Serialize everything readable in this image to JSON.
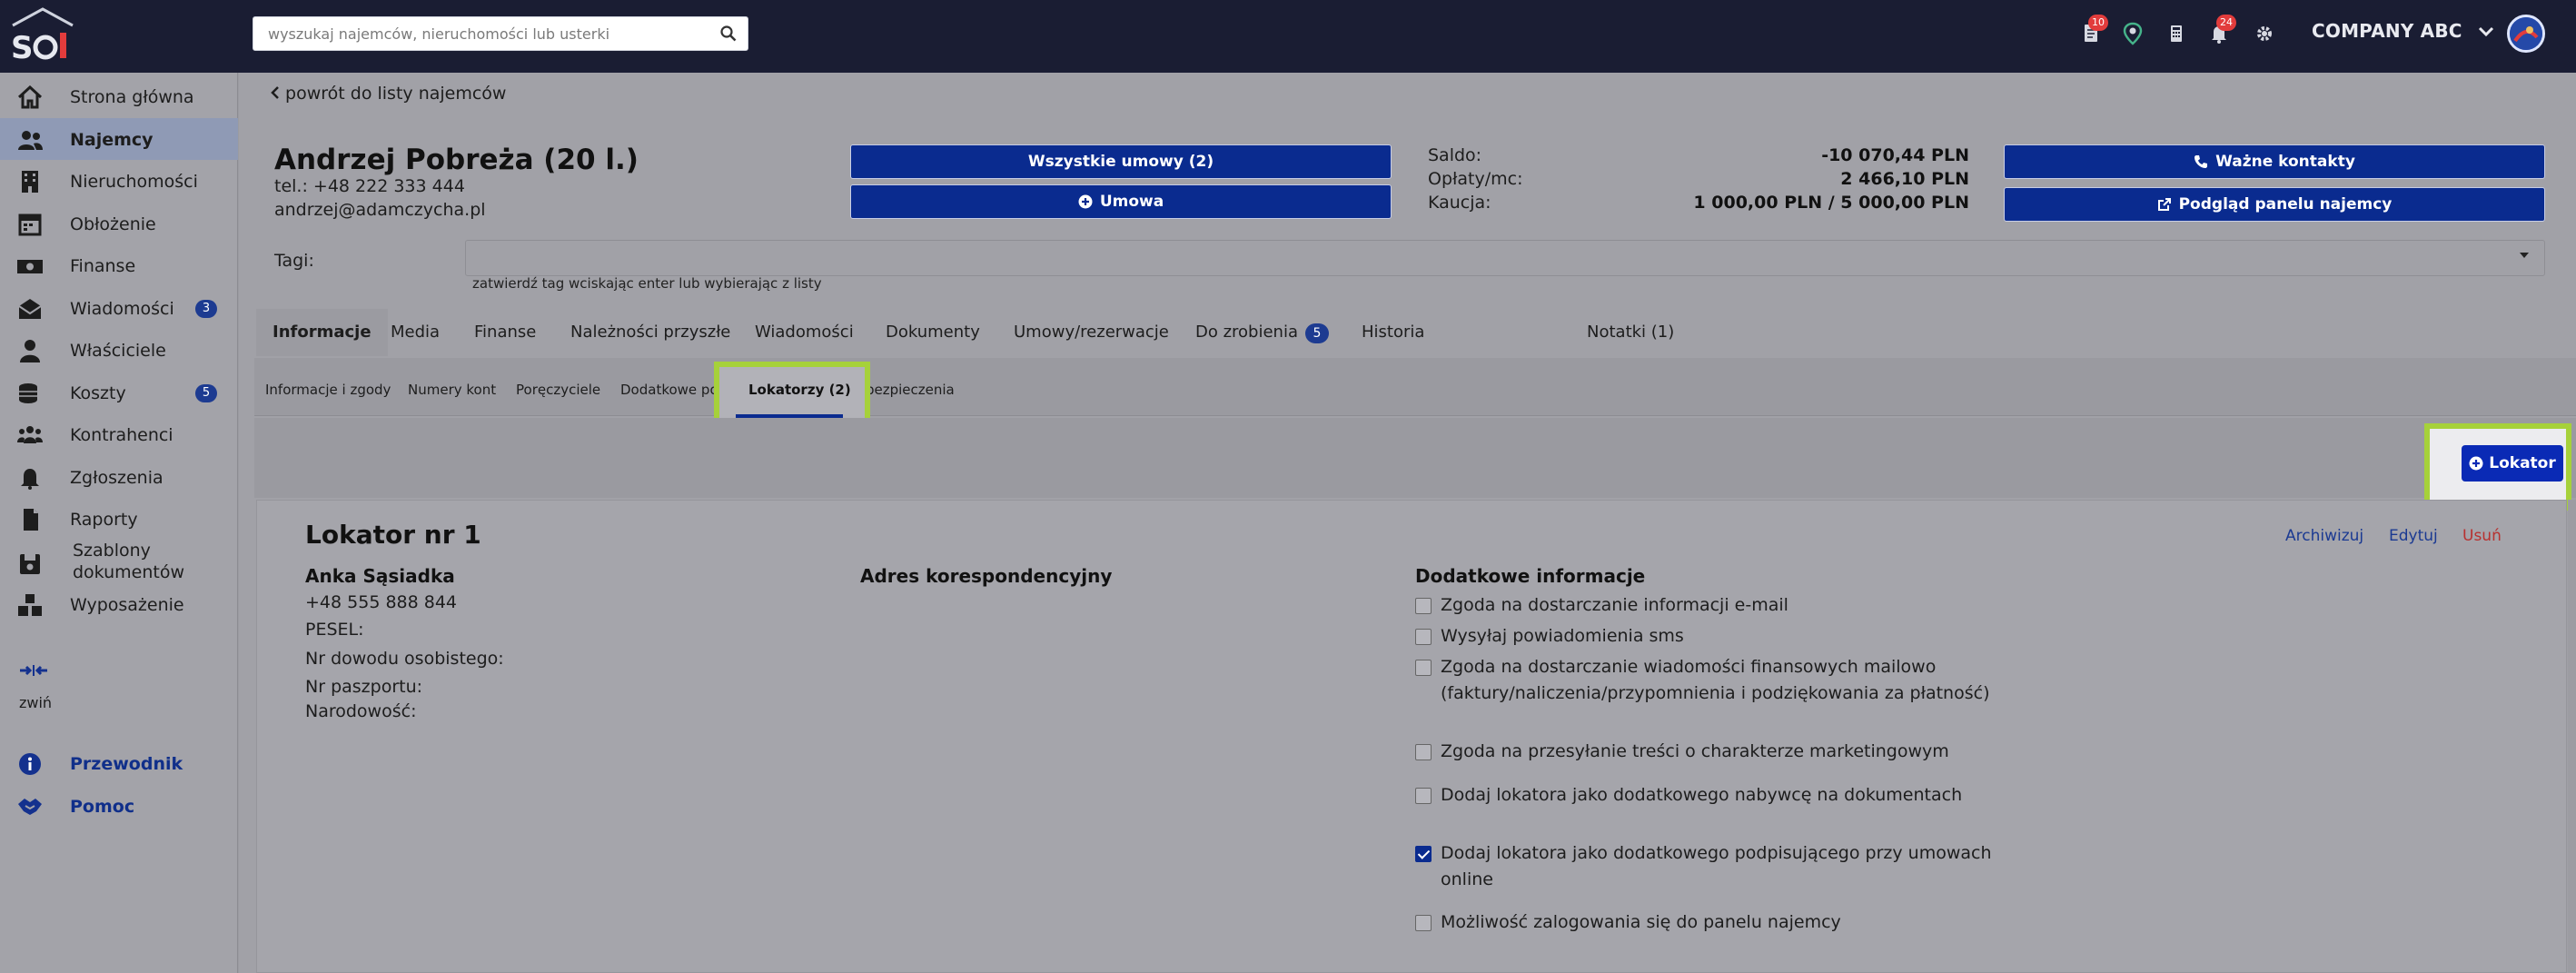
{
  "search": {
    "placeholder": "wyszukaj najemców, nieruchomości lub usterki"
  },
  "topbar": {
    "badges": {
      "documents": "10",
      "bell": "24"
    },
    "company": "COMPANY ABC"
  },
  "sidebar": {
    "items": [
      {
        "label": "Strona główna",
        "icon": "home-icon"
      },
      {
        "label": "Najemcy",
        "icon": "users-icon"
      },
      {
        "label": "Nieruchomości",
        "icon": "building-icon"
      },
      {
        "label": "Obłożenie",
        "icon": "calendar-icon"
      },
      {
        "label": "Finanse",
        "icon": "money-icon"
      },
      {
        "label": "Wiadomości",
        "icon": "envelope-icon",
        "count": "3"
      },
      {
        "label": "Właściciele",
        "icon": "owner-icon"
      },
      {
        "label": "Koszty",
        "icon": "coins-icon",
        "count": "5"
      },
      {
        "label": "Kontrahenci",
        "icon": "group-icon"
      },
      {
        "label": "Zgłoszenia",
        "icon": "bell-icon"
      },
      {
        "label": "Raporty",
        "icon": "file-icon"
      },
      {
        "label_line1": "Szablony",
        "label_line2": "dokumentów",
        "icon": "save-icon"
      },
      {
        "label": "Wyposażenie",
        "icon": "boxes-icon"
      }
    ],
    "collapse_label": "zwiń",
    "guide_label": "Przewodnik",
    "help_label": "Pomoc"
  },
  "main": {
    "back_link": "powrót do listy najemców",
    "tenant_name": "Andrzej Pobreża (20  l.)",
    "phone": "tel.: +48 222 333 444",
    "email": "andrzej@adamczycha.pl",
    "all_contracts_button": "Wszystkie umowy (2)",
    "contract_button": "Umowa",
    "finance": {
      "balance_label": "Saldo:",
      "balance_value": "-10 070,44 PLN",
      "fees_label": "Opłaty/mc:",
      "fees_value": "2 466,10 PLN",
      "deposit_label": "Kaucja:",
      "deposit_value": "1 000,00 PLN / 5 000,00 PLN"
    },
    "important_contacts_button": "Ważne kontakty",
    "tenant_panel_button": "Podgląd panelu najemcy",
    "tags_label": "Tagi:",
    "tags_hint": "zatwierdź tag wciskając enter lub wybierając z listy",
    "tabs": [
      {
        "label": "Informacje"
      },
      {
        "label": "Media"
      },
      {
        "label": "Finanse"
      },
      {
        "label": "Należności przyszłe"
      },
      {
        "label": "Wiadomości"
      },
      {
        "label": "Dokumenty"
      },
      {
        "label": "Umowy/rezerwacje"
      },
      {
        "label": "Do zrobienia",
        "count": "5"
      },
      {
        "label": "Historia"
      },
      {
        "label": "Notatki (1)"
      }
    ],
    "subtabs": [
      {
        "label": "Informacje i zgody"
      },
      {
        "label": "Numery kont"
      },
      {
        "label": "Poręczyciele"
      },
      {
        "label": "Dodatkowe po"
      },
      {
        "label": "Lokatorzy (2)"
      },
      {
        "label": "Ubezpieczenia"
      }
    ],
    "add_lokator_button": "Lokator"
  },
  "lokator": {
    "title": "Lokator nr 1",
    "archive_link": "Archiwizuj",
    "edit_link": "Edytuj",
    "delete_link": "Usuń",
    "name": "Anka Sąsiadka",
    "phone": "+48 555 888 844",
    "pesel_label": "PESEL:",
    "id_label": "Nr dowodu osobistego:",
    "passport_label": "Nr paszportu:",
    "nationality_label": "Narodowość:",
    "address_heading": "Adres korespondencyjny",
    "extra_heading": "Dodatkowe informacje",
    "checkboxes": [
      {
        "label": "Zgoda na dostarczanie informacji e-mail",
        "checked": false
      },
      {
        "label": "Wysyłaj powiadomienia sms",
        "checked": false
      },
      {
        "label": "Zgoda na dostarczanie wiadomości finansowych mailowo (faktury/naliczenia/przypomnienia i podziękowania za płatność)",
        "checked": false
      },
      {
        "label": "Zgoda na przesyłanie treści o charakterze marketingowym",
        "checked": false
      },
      {
        "label": "Dodaj lokatora jako dodatkowego nabywcę na dokumentach",
        "checked": false
      },
      {
        "label": "Dodaj lokatora jako dodatkowego podpisującego przy umowach online",
        "checked": true
      },
      {
        "label": "Możliwość zalogowania się do panelu najemcy",
        "checked": false
      }
    ]
  },
  "colors": {
    "navy": "#1a1d33",
    "primary": "#0a2b8f",
    "highlight": "#a6d13a",
    "danger": "#b8312f"
  }
}
